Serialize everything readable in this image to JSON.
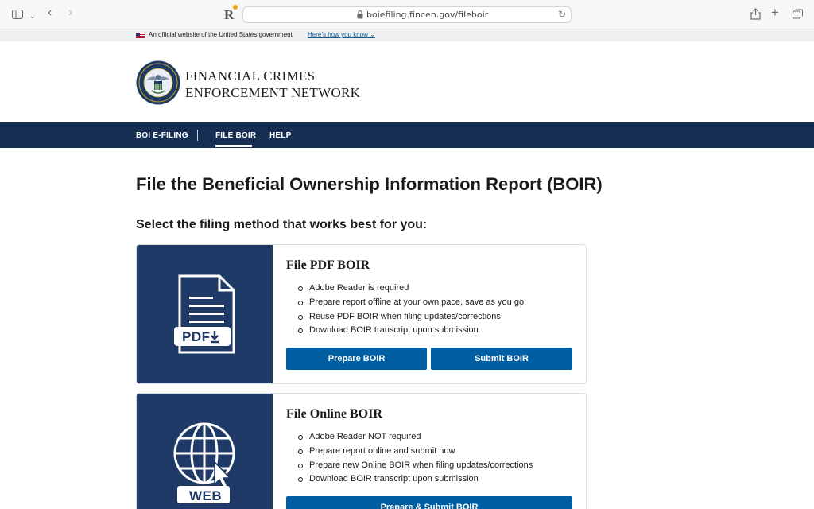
{
  "browser": {
    "url": "boiefiling.fincen.gov/fileboir"
  },
  "gov_banner": {
    "text": "An official website of the United States government",
    "link": "Here’s how you know"
  },
  "header": {
    "org_line1": "FINANCIAL CRIMES",
    "org_line2": "ENFORCEMENT NETWORK"
  },
  "nav": {
    "items": [
      {
        "label": "BOI E-FILING"
      },
      {
        "label": "FILE BOIR",
        "active": true
      },
      {
        "label": "HELP"
      }
    ]
  },
  "main": {
    "title": "File the Beneficial Ownership Information Report (BOIR)",
    "subtitle": "Select the filing method that works best for you:",
    "cards": [
      {
        "heading": "File PDF BOIR",
        "icon_label": "PDF",
        "icon": "pdf-download-icon",
        "bullets": [
          "Adobe Reader is required",
          "Prepare report offline at your own pace, save as you go",
          "Reuse PDF BOIR when filing updates/corrections",
          "Download BOIR transcript upon submission"
        ],
        "buttons": [
          "Prepare BOIR",
          "Submit BOIR"
        ]
      },
      {
        "heading": "File Online BOIR",
        "icon_label": "WEB",
        "icon": "globe-cursor-icon",
        "bullets": [
          "Adobe Reader NOT required",
          "Prepare report online and submit now",
          "Prepare new Online BOIR when filing updates/corrections",
          "Download BOIR transcript upon submission"
        ],
        "buttons": [
          "Prepare & Submit BOIR"
        ]
      }
    ]
  },
  "colors": {
    "nav_bg": "#162e51",
    "card_media_bg": "#1f3a66",
    "button_bg": "#005ea2"
  }
}
